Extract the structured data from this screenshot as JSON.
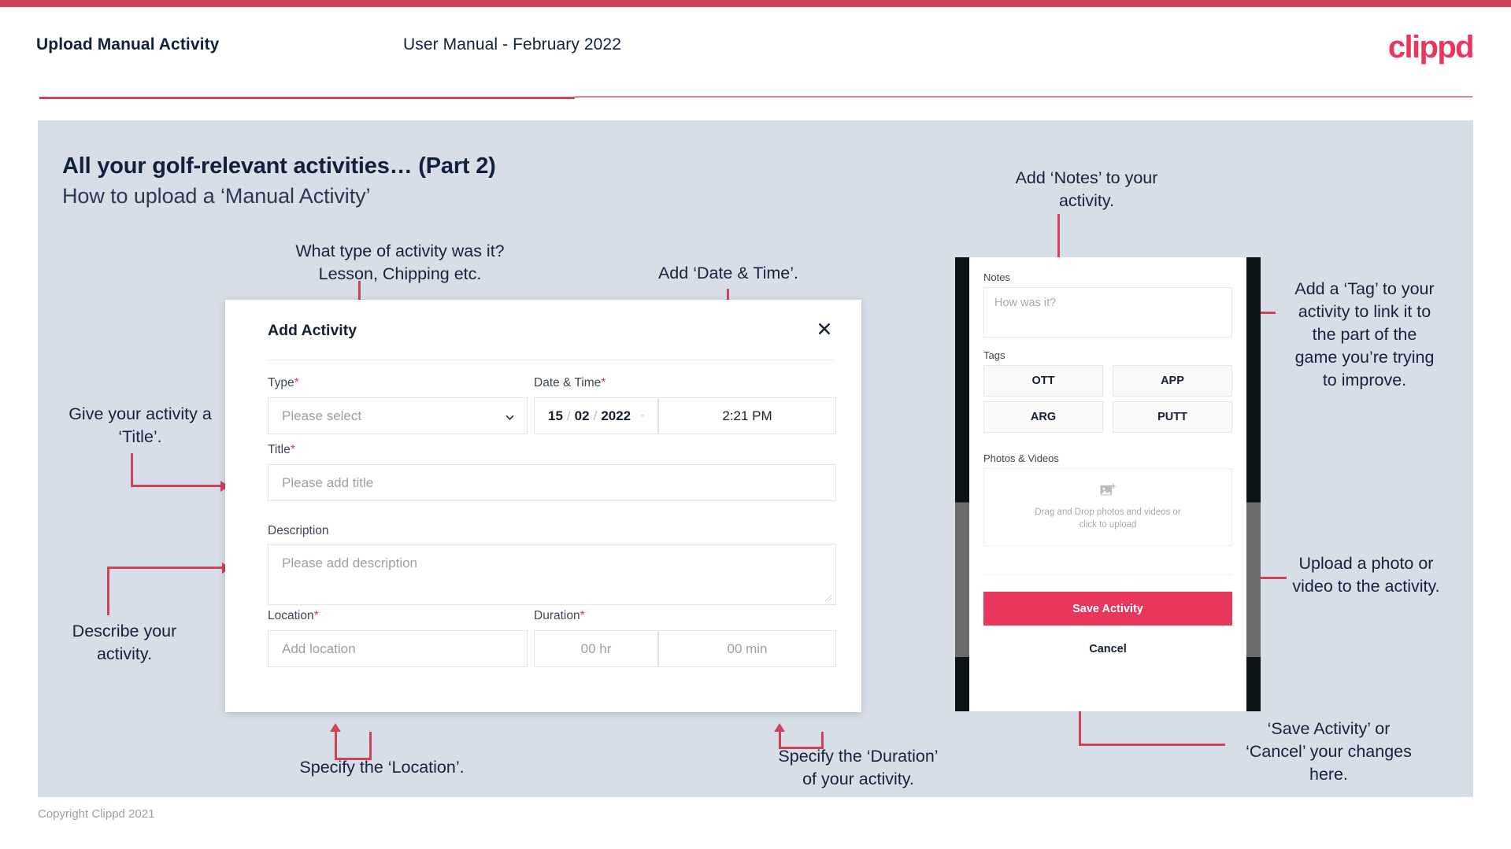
{
  "header": {
    "title": "Upload Manual Activity",
    "subtitle": "User Manual - February 2022",
    "logo": "clippd"
  },
  "slide": {
    "title": "All your golf-relevant activities… (Part 2)",
    "subtitle": "How to upload a ‘Manual Activity’"
  },
  "callouts": {
    "type": "What type of activity was it?\nLesson, Chipping etc.",
    "datetime": "Add ‘Date & Time’.",
    "title": "Give your activity a\n‘Title’.",
    "description": "Describe your\nactivity.",
    "location": "Specify the ‘Location’.",
    "duration": "Specify the ‘Duration’\nof your activity.",
    "notes": "Add ‘Notes’ to your\nactivity.",
    "tags": "Add a ‘Tag’ to your\nactivity to link it to\nthe part of the\ngame you’re trying\nto improve.",
    "photos": "Upload a photo or\nvideo to the activity.",
    "save": "‘Save Activity’ or\n‘Cancel’ your changes\nhere."
  },
  "dialog": {
    "title": "Add Activity",
    "close_icon": "close-icon",
    "fields": {
      "type": {
        "label": "Type",
        "required": "*",
        "placeholder": "Please select"
      },
      "datetime": {
        "label": "Date & Time",
        "required": "*",
        "day": "15",
        "sep1": "/",
        "month": "02",
        "sep2": "/",
        "year": "2022",
        "time": "2:21 PM"
      },
      "title": {
        "label": "Title",
        "required": "*",
        "placeholder": "Please add title"
      },
      "description": {
        "label": "Description",
        "placeholder": "Please add description"
      },
      "location": {
        "label": "Location",
        "required": "*",
        "placeholder": "Add location"
      },
      "duration": {
        "label": "Duration",
        "required": "*",
        "hours": "00 hr",
        "minutes": "00 min"
      }
    }
  },
  "phone": {
    "notes": {
      "label": "Notes",
      "placeholder": "How was it?"
    },
    "tags": {
      "label": "Tags",
      "items": [
        "OTT",
        "APP",
        "ARG",
        "PUTT"
      ]
    },
    "photos": {
      "label": "Photos & Videos",
      "dropzone_text": "Drag and Drop photos and videos or\nclick to upload"
    },
    "save_label": "Save Activity",
    "cancel_label": "Cancel"
  },
  "footer": {
    "copyright": "Copyright Clippd 2021"
  },
  "colors": {
    "accent": "#e8365d",
    "connector": "#cf4257",
    "slide_bg": "#d8dee7",
    "ink": "#11203c"
  }
}
